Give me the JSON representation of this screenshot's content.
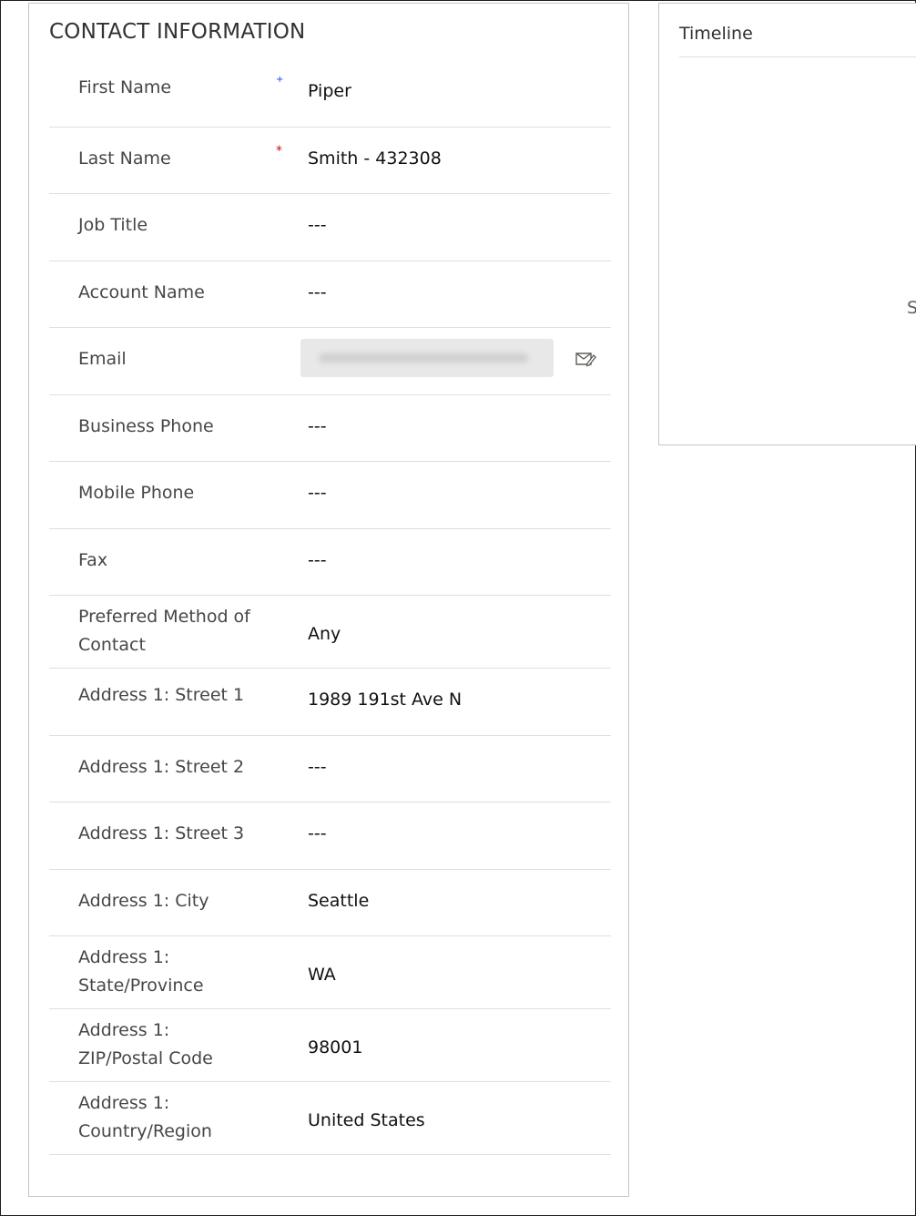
{
  "section": {
    "title": "CONTACT INFORMATION"
  },
  "fields": [
    {
      "label": "First Name",
      "value": "Piper",
      "required": "recommended"
    },
    {
      "label": "Last Name",
      "value": "Smith - 432308",
      "required": "required"
    },
    {
      "label": "Job Title",
      "value": "---"
    },
    {
      "label": "Account Name",
      "value": "---"
    },
    {
      "label": "Email",
      "value": "",
      "blurred": true
    },
    {
      "label": "Business Phone",
      "value": "---"
    },
    {
      "label": "Mobile Phone",
      "value": "---"
    },
    {
      "label": "Fax",
      "value": "---"
    },
    {
      "label": "Preferred Method of Contact",
      "value": "Any"
    },
    {
      "label": "Address 1: Street 1",
      "value": "1989 191st Ave N"
    },
    {
      "label": "Address 1: Street 2",
      "value": "---"
    },
    {
      "label": "Address 1: Street 3",
      "value": "---"
    },
    {
      "label": "Address 1: City",
      "value": "Seattle"
    },
    {
      "label": "Address 1: State/Province",
      "value": "WA"
    },
    {
      "label": "Address 1: ZIP/Postal Code",
      "value": "98001"
    },
    {
      "label": "Address 1: Country/Region",
      "value": "United States"
    }
  ],
  "markers": {
    "recommended": "+",
    "required": "*"
  },
  "icons": {
    "email_action": "send-email-icon"
  },
  "timeline": {
    "title": "Timeline",
    "partial_text": "S"
  },
  "colors": {
    "required": "#c50f1f",
    "recommended": "#1b3de0"
  }
}
